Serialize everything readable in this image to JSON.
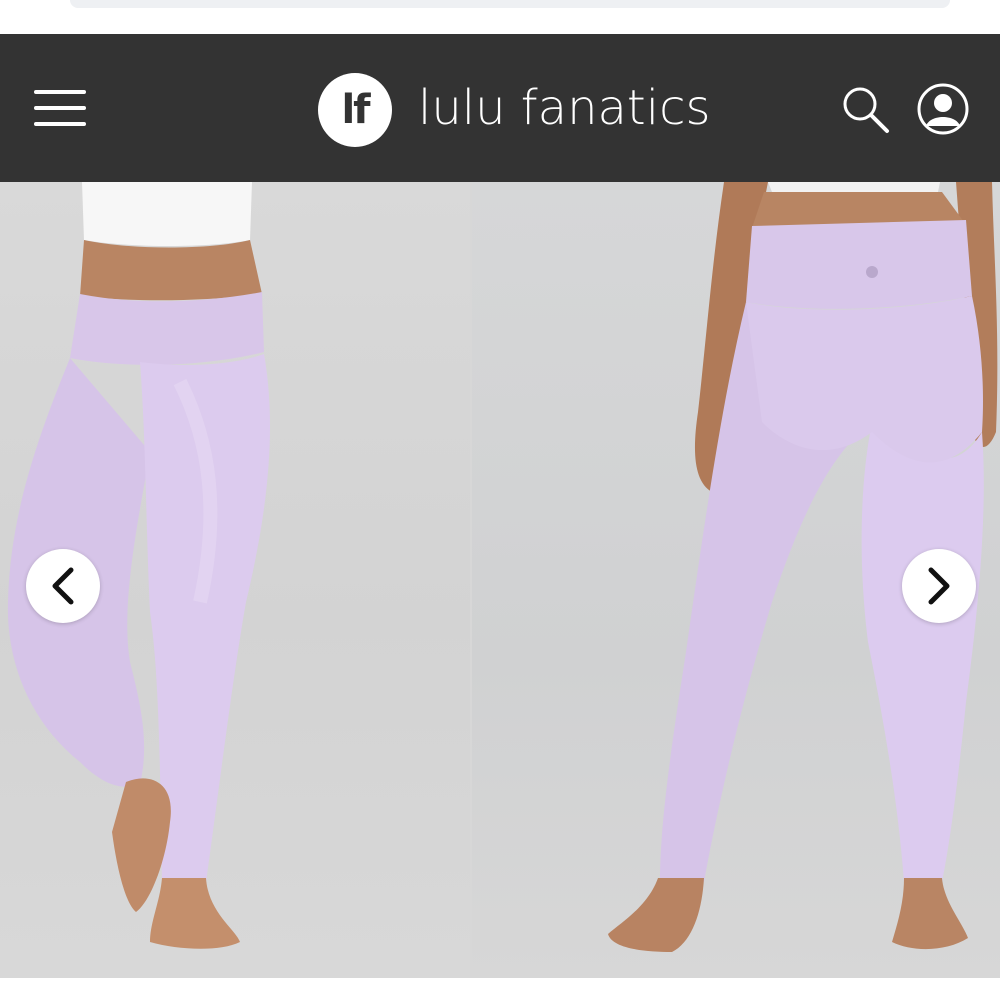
{
  "header": {
    "logo_text": "lf",
    "brand_name": "lulu fanatics",
    "menu_icon": "hamburger-menu-icon",
    "search_icon": "search-icon",
    "account_icon": "user-account-icon"
  },
  "gallery": {
    "prev_icon": "chevron-left-icon",
    "next_icon": "chevron-right-icon",
    "images": [
      {
        "view": "front"
      },
      {
        "view": "back"
      }
    ]
  },
  "colors": {
    "header_bg": "#333333",
    "leggings": "#d9c8ea",
    "backdrop": "#d6d6d6"
  }
}
